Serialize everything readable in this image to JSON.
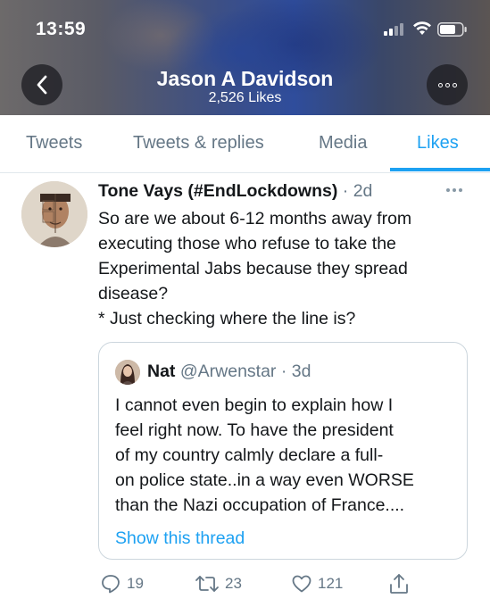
{
  "status_bar": {
    "time": "13:59"
  },
  "header": {
    "name": "Jason A Davidson",
    "likes_count": "2,526 Likes"
  },
  "tabs": [
    {
      "label": "Tweets"
    },
    {
      "label": "Tweets & replies"
    },
    {
      "label": "Media"
    },
    {
      "label": "Likes",
      "active": true
    }
  ],
  "tweet": {
    "author_name": "Tone Vays (#EndLockdowns)",
    "separator": " · ",
    "time": "2d",
    "text_lines": [
      "So are we about 6-12 months away from",
      "executing those who refuse to take the",
      "Experimental Jabs because they spread",
      "disease?",
      "* Just checking where the line is?"
    ],
    "quote": {
      "author_name": "Nat",
      "handle": "@Arwenstar",
      "separator": " · ",
      "time": "3d",
      "text_lines": [
        "I cannot even begin to explain how I",
        "feel right now. To have the president",
        "of my country calmly declare a full-",
        "on police state..in a way even WORSE",
        "than the Nazi occupation of France...."
      ],
      "show_thread": "Show this thread"
    },
    "actions": {
      "reply_count": "19",
      "retweet_count": "23",
      "like_count": "121"
    }
  },
  "colors": {
    "accent": "#1da1f2",
    "secondary_text": "#657786"
  }
}
